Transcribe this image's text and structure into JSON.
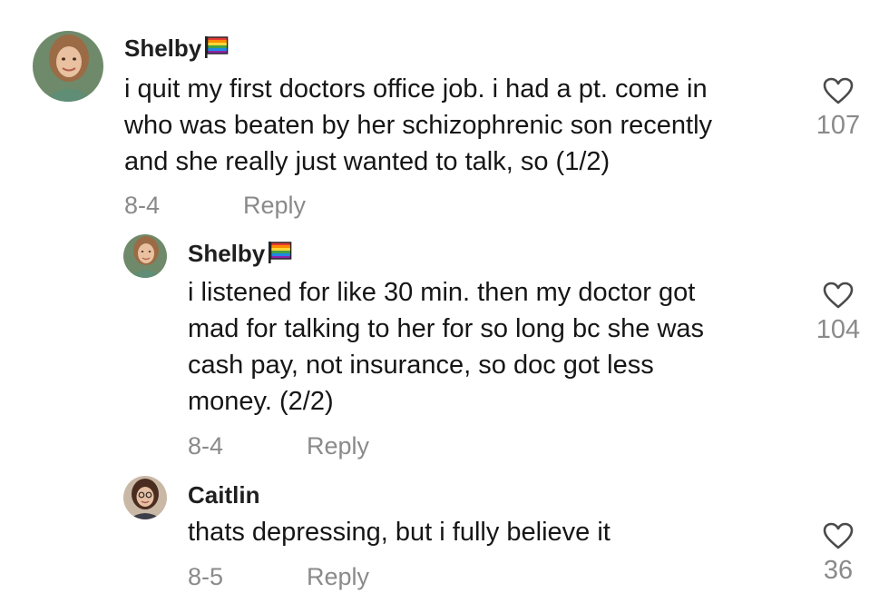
{
  "comments": [
    {
      "author": "Shelby",
      "lines": [
        "i quit my first doctors office job. i had a pt. come in",
        "who was beaten by her schizophrenic son recently",
        "and she really just wanted to talk, so (1/2)"
      ],
      "date": "8-4",
      "reply_label": "Reply",
      "likes": "107",
      "avatar_icon": "avatar-photo",
      "flag_icon": "rainbow-flag-icon"
    },
    {
      "author": "Shelby",
      "lines": [
        "i listened for like 30 min. then my doctor got",
        "mad for talking to her for so long bc she was",
        "cash pay, not insurance, so doc got less",
        "money. (2/2)"
      ],
      "date": "8-4",
      "reply_label": "Reply",
      "likes": "104",
      "avatar_icon": "avatar-photo",
      "flag_icon": "rainbow-flag-icon"
    },
    {
      "author": "Caitlin",
      "lines": [
        "thats depressing, but i fully believe it"
      ],
      "date": "8-5",
      "reply_label": "Reply",
      "likes": "36",
      "avatar_icon": "avatar-photo"
    }
  ],
  "colors": {
    "text": "#161616",
    "muted": "#8a8a8a",
    "heart_stroke": "#4a4a4a"
  }
}
